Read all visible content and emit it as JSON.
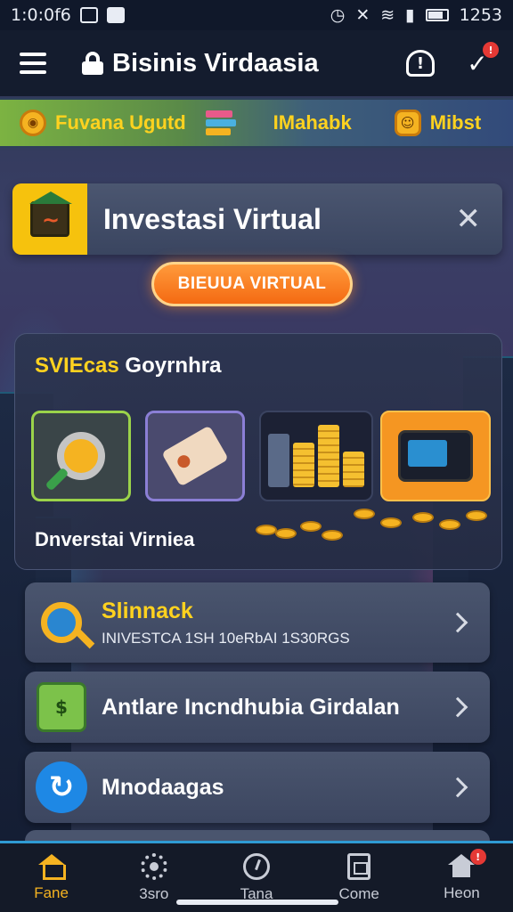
{
  "status_bar": {
    "time": "1:0:0f6",
    "clock": "1253"
  },
  "app_bar": {
    "title": "Bisinis Virdaasia",
    "menu_icon": "hamburger-icon",
    "alert_icon": "alert-icon",
    "notification_icon": "notification-icon",
    "notification_badge": "!"
  },
  "promo_bar": {
    "items": [
      {
        "label": "Fuvana Ugutd",
        "icon": "coin-icon"
      },
      {
        "label": "IMahabk",
        "icon": "books-icon"
      },
      {
        "label": "Mibst",
        "icon": "face-icon"
      }
    ]
  },
  "investment_card": {
    "title": "Investasi Virtual",
    "close_icon": "close-icon"
  },
  "cta_button": {
    "label": "BIEUUA VIRTUAL"
  },
  "panel": {
    "title_highlight": "SVIEcas",
    "title_rest": " Goyrnhra",
    "footer": "Dnverstai Virniea",
    "tiles": [
      {
        "icon": "magnifier-icon"
      },
      {
        "icon": "price-tag-icon"
      },
      {
        "icon": "gold-stack-icon"
      },
      {
        "icon": "device-icon"
      }
    ]
  },
  "list": [
    {
      "title": "Slinnack",
      "subtitle": "INIVESTCA 1SH 10eRbAI 1S30RGS",
      "icon": "key-icon"
    },
    {
      "title": "Antlare Incndhubia Girdalan",
      "subtitle": "",
      "icon": "cash-icon"
    },
    {
      "title": "Mnodaagas",
      "subtitle": "",
      "icon": "refresh-icon"
    }
  ],
  "bottom_nav": [
    {
      "label": "Fane",
      "icon": "home-icon",
      "active": true
    },
    {
      "label": "3sro",
      "icon": "gear-icon",
      "active": false
    },
    {
      "label": "Tana",
      "icon": "clock-icon",
      "active": false
    },
    {
      "label": "Come",
      "icon": "document-icon",
      "active": false
    },
    {
      "label": "Heon",
      "icon": "house-icon",
      "active": false,
      "badge": "!"
    }
  ],
  "colors": {
    "accent": "#f5b321",
    "cta": "#f46a12",
    "highlight_text": "#ffd21f",
    "nav_divider": "#2f9bd4",
    "badge": "#e53935"
  }
}
